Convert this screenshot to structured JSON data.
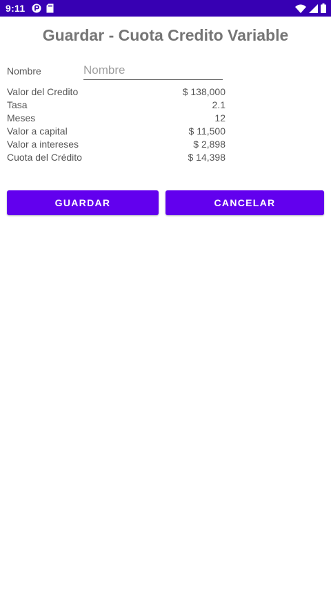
{
  "status_bar": {
    "time": "9:11",
    "background": "#3700b3",
    "left_icons": [
      "notification-app-icon",
      "sd-card-icon"
    ],
    "right_icons": [
      "wifi-icon",
      "signal-icon",
      "battery-icon"
    ]
  },
  "page": {
    "title": "Guardar - Cuota Credito Variable"
  },
  "form": {
    "name_label": "Nombre",
    "name_placeholder": "Nombre",
    "name_value": ""
  },
  "summary": {
    "rows": [
      {
        "label": "Valor del Credito",
        "value": "$ 138,000"
      },
      {
        "label": "Tasa",
        "value": "2.1"
      },
      {
        "label": "Meses",
        "value": "12"
      },
      {
        "label": "Valor a capital",
        "value": "$ 11,500"
      },
      {
        "label": "Valor a intereses",
        "value": "$ 2,898"
      },
      {
        "label": "Cuota del Crédito",
        "value": "$ 14,398"
      }
    ]
  },
  "actions": {
    "save_label": "GUARDAR",
    "cancel_label": "CANCELAR",
    "accent": "#6200ee"
  }
}
